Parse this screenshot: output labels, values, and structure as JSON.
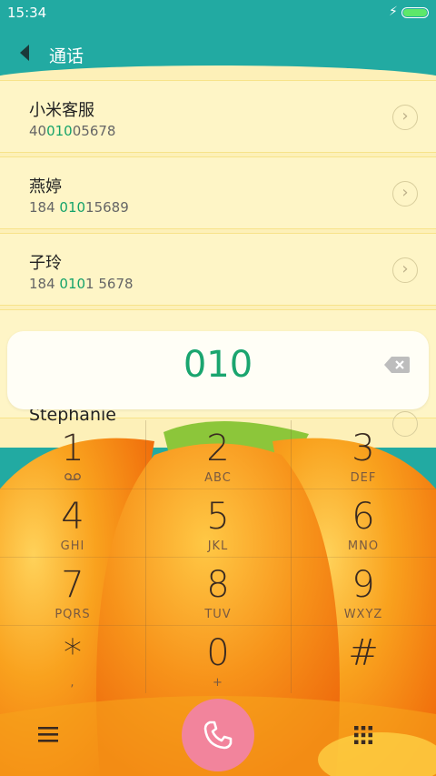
{
  "status_bar": {
    "time": "15:34",
    "charging_icon": "bolt-icon",
    "battery_icon": "battery-icon",
    "battery_color": "#5de86a"
  },
  "header": {
    "title": "通话",
    "back_icon": "back-arrow-icon"
  },
  "contacts": [
    {
      "name": "小米客服",
      "number_pre": "40",
      "number_hl": "010",
      "number_post": "05678"
    },
    {
      "name": "燕婷",
      "number_pre": "184 ",
      "number_hl": "010",
      "number_post": "15689"
    },
    {
      "name": "子玲",
      "number_pre": "184 ",
      "number_hl": "010",
      "number_post": "1 5678"
    },
    {
      "name": "Stephanie"
    }
  ],
  "input": {
    "digits": "010",
    "delete_icon": "backspace-icon"
  },
  "keypad": [
    {
      "digit": "1",
      "letters": "",
      "icon": "voicemail-icon"
    },
    {
      "digit": "2",
      "letters": "ABC"
    },
    {
      "digit": "3",
      "letters": "DEF"
    },
    {
      "digit": "4",
      "letters": "GHI"
    },
    {
      "digit": "5",
      "letters": "JKL"
    },
    {
      "digit": "6",
      "letters": "MNO"
    },
    {
      "digit": "7",
      "letters": "PQRS"
    },
    {
      "digit": "8",
      "letters": "TUV"
    },
    {
      "digit": "9",
      "letters": "WXYZ"
    },
    {
      "digit": "*",
      "letters": ","
    },
    {
      "digit": "0",
      "letters": "+"
    },
    {
      "digit": "#",
      "letters": ""
    }
  ],
  "bottom": {
    "menu_icon": "menu-icon",
    "call_icon": "phone-icon",
    "dialpad_icon": "dialpad-icon"
  },
  "colors": {
    "teal": "#22aaa2",
    "highlight": "#15a36a",
    "call_button": "#f2849c",
    "pumpkin": "#f58a14"
  }
}
